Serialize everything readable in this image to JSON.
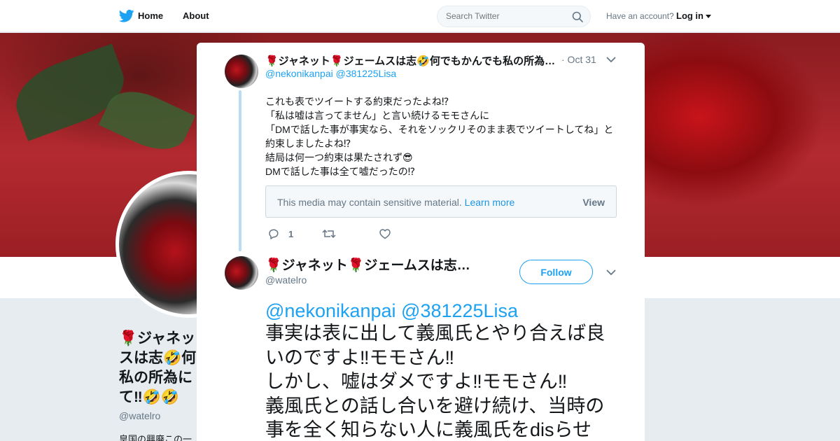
{
  "nav": {
    "home_label": "Home",
    "about_label": "About",
    "search_placeholder": "Search Twitter",
    "account_prompt": "Have an account?",
    "login_label": "Log in"
  },
  "profile": {
    "name_lines": [
      "🌹ジャネッ",
      "ス",
      "は志🤣何",
      "私の所為に",
      "て‼🤣🤣"
    ],
    "handle": "@watelro",
    "bio_preview": "皇国の興廃この一"
  },
  "tweet1": {
    "author": "🌹ジャネット🌹ジェームスは志🤣何でもかんでも私の所為に…",
    "date": "· Oct 31",
    "reply_to": "@nekonikanpai @381225Lisa",
    "lines": [
      "これも表でツイートする約束だったよね⁉",
      "「私は嘘は言ってません」と言い続けるモモさんに",
      "「DMで話した事が事実なら、それをソックリそのまま表でツイートしてね」と",
      "約束しましたよね⁉",
      "結局は何一つ約束は果たされず😎",
      "DMで話した事は全て嘘だったの⁉"
    ],
    "sensitive_text": "This media may contain sensitive material.",
    "learn_more": "Learn more",
    "view_label": "View",
    "reply_count": "1"
  },
  "tweet2": {
    "author": "🌹ジャネット🌹ジェームスは志🤣…",
    "handle": "@watelro",
    "follow_label": "Follow",
    "mentions": "@nekonikanpai @381225Lisa",
    "lines": [
      "事実は表に出して義風氏とやり合えば良",
      "いのですよ‼モモさん‼",
      "しかし、嘘はダメですよ‼モモさん‼",
      "義風氏との話し合いを避け続け、当時の",
      "事を全く知らない人に義風氏をdisらせ"
    ]
  },
  "colors": {
    "accent": "#1da1f2",
    "text": "#14171a",
    "muted": "#657786",
    "thread_line": "#b8dcf5"
  }
}
